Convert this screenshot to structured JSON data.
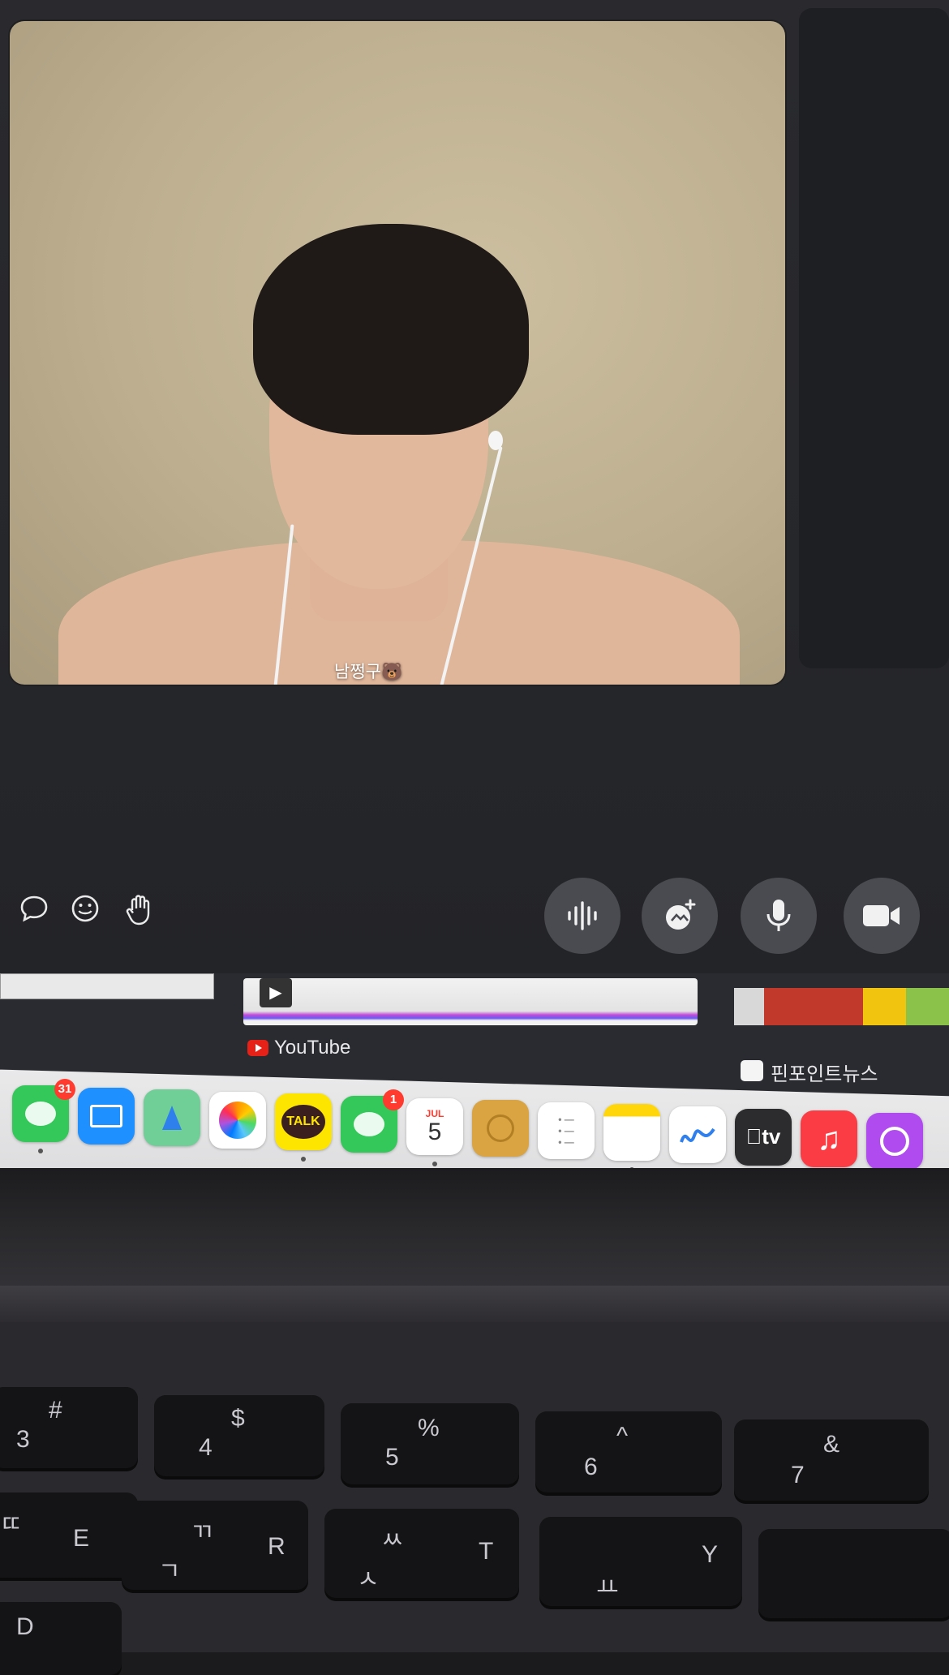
{
  "call": {
    "participant_name": "남쩡구🐻"
  },
  "controls": {
    "left": [
      {
        "name": "chat-icon",
        "glyph": "💬"
      },
      {
        "name": "reactions-icon",
        "glyph": "☺"
      },
      {
        "name": "raise-hand-icon",
        "glyph": "✋"
      }
    ],
    "right": [
      {
        "name": "audio-waveform-icon"
      },
      {
        "name": "effects-icon"
      },
      {
        "name": "microphone-icon"
      },
      {
        "name": "camera-icon"
      }
    ]
  },
  "widgets": {
    "youtube_label": "YouTube",
    "news_label": "핀포인트뉴스"
  },
  "dock": {
    "apps": [
      {
        "name": "messages",
        "label": "",
        "badge": "31",
        "color": "#34c759",
        "running": true
      },
      {
        "name": "mail",
        "label": "",
        "badge": "",
        "color": "#1e90ff",
        "running": false
      },
      {
        "name": "maps",
        "label": "",
        "badge": "",
        "color": "#6fcf97",
        "running": false
      },
      {
        "name": "photos",
        "label": "",
        "badge": "",
        "color": "#ffffff",
        "running": false
      },
      {
        "name": "kakaotalk",
        "label": "TALK",
        "badge": "",
        "color": "#fee500",
        "running": true
      },
      {
        "name": "facetime",
        "label": "",
        "badge": "1",
        "color": "#34c759",
        "running": false
      },
      {
        "name": "calendar",
        "label": "5",
        "month": "JUL",
        "badge": "",
        "color": "#ffffff",
        "running": true
      },
      {
        "name": "contacts",
        "label": "",
        "badge": "",
        "color": "#d9a441",
        "running": false
      },
      {
        "name": "reminders",
        "label": "",
        "badge": "",
        "color": "#ffffff",
        "running": false
      },
      {
        "name": "notes",
        "label": "",
        "badge": "",
        "color": "#ffffff",
        "running": true
      },
      {
        "name": "freeform",
        "label": "",
        "badge": "",
        "color": "#ffffff",
        "running": false
      },
      {
        "name": "apple-tv",
        "label": "tv",
        "badge": "",
        "color": "#2c2c2e",
        "running": false
      },
      {
        "name": "music",
        "label": "♫",
        "badge": "",
        "color": "#fc3c44",
        "running": false
      },
      {
        "name": "podcasts",
        "label": "",
        "badge": "",
        "color": "#b04bf0",
        "running": false
      }
    ]
  },
  "keyboard": {
    "keys": [
      {
        "top": "#",
        "bottom": "3"
      },
      {
        "top": "$",
        "bottom": "4"
      },
      {
        "top": "%",
        "bottom": "5"
      },
      {
        "top": "^",
        "bottom": "6"
      },
      {
        "top": "&",
        "bottom": "7"
      },
      {
        "top": "ㄸ",
        "bottom": "E"
      },
      {
        "top": "ㄲ",
        "bottom": "R"
      },
      {
        "top": "ㅆ",
        "bottom": "T"
      },
      {
        "top": "",
        "bottom": "Y"
      },
      {
        "top": "ㄱ",
        "bottom": ""
      },
      {
        "top": "ㅅ",
        "bottom": ""
      },
      {
        "top": "ㅛ",
        "bottom": ""
      },
      {
        "top": "",
        "bottom": "D"
      }
    ]
  }
}
